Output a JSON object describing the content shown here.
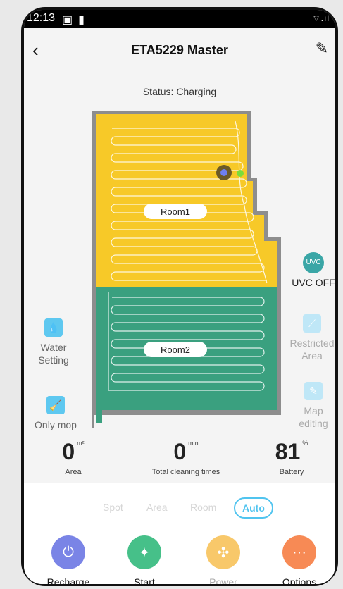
{
  "statusbar": {
    "time": "12:13",
    "signal": "⌔.ıl"
  },
  "header": {
    "title": "ETA5229 Master"
  },
  "status_text": "Status: Charging",
  "map": {
    "rooms": [
      {
        "label": "Room1",
        "color": "#f7c928"
      },
      {
        "label": "Room2",
        "color": "#3aa07f"
      }
    ]
  },
  "left_controls": {
    "water_setting": "Water\nSetting",
    "only_mop": "Only mop"
  },
  "right_controls": {
    "uvc": "UVC OFF",
    "restricted": "Restricted\nArea",
    "map_edit": "Map\nediting"
  },
  "stats": [
    {
      "value": "0",
      "unit": "m²",
      "label": "Area"
    },
    {
      "value": "0",
      "unit": "min",
      "label": "Total cleaning times"
    },
    {
      "value": "81",
      "unit": "%",
      "label": "Battery"
    }
  ],
  "modes": [
    "Spot",
    "Area",
    "Room",
    "Auto"
  ],
  "actions": [
    {
      "label": "Recharge",
      "color": "#7a84e6"
    },
    {
      "label": "Start",
      "color": "#46c089"
    },
    {
      "label": "Power",
      "color": "#f8c86a"
    },
    {
      "label": "Options",
      "color": "#f78a55"
    }
  ],
  "colors": {
    "accent": "#50c4ef",
    "wall": "#8d8d8d"
  }
}
